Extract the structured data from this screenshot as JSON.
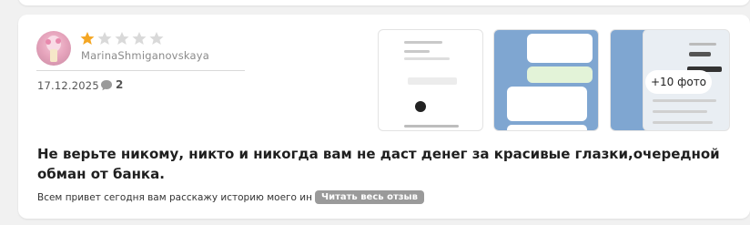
{
  "review": {
    "username": "MarinaShmiganovskaya",
    "rating": 1,
    "max_rating": 5,
    "date": "17.12.2025",
    "comments_count": "2",
    "headline": "Не верьте никому, никто и никогда вам не даст денег за красивые глазки,очередной обман от банка.",
    "preview_text": "Всем привет сегодня вам расскажу историю моего ин",
    "read_more_label": "Читать весь отзыв",
    "more_photos_label": "+10 фото"
  },
  "colors": {
    "star_filled": "#f4a623",
    "star_empty": "#d9d9d9",
    "read_more_bg": "#9a9a9a"
  },
  "icons": [
    "comment-icon",
    "star-icon"
  ]
}
